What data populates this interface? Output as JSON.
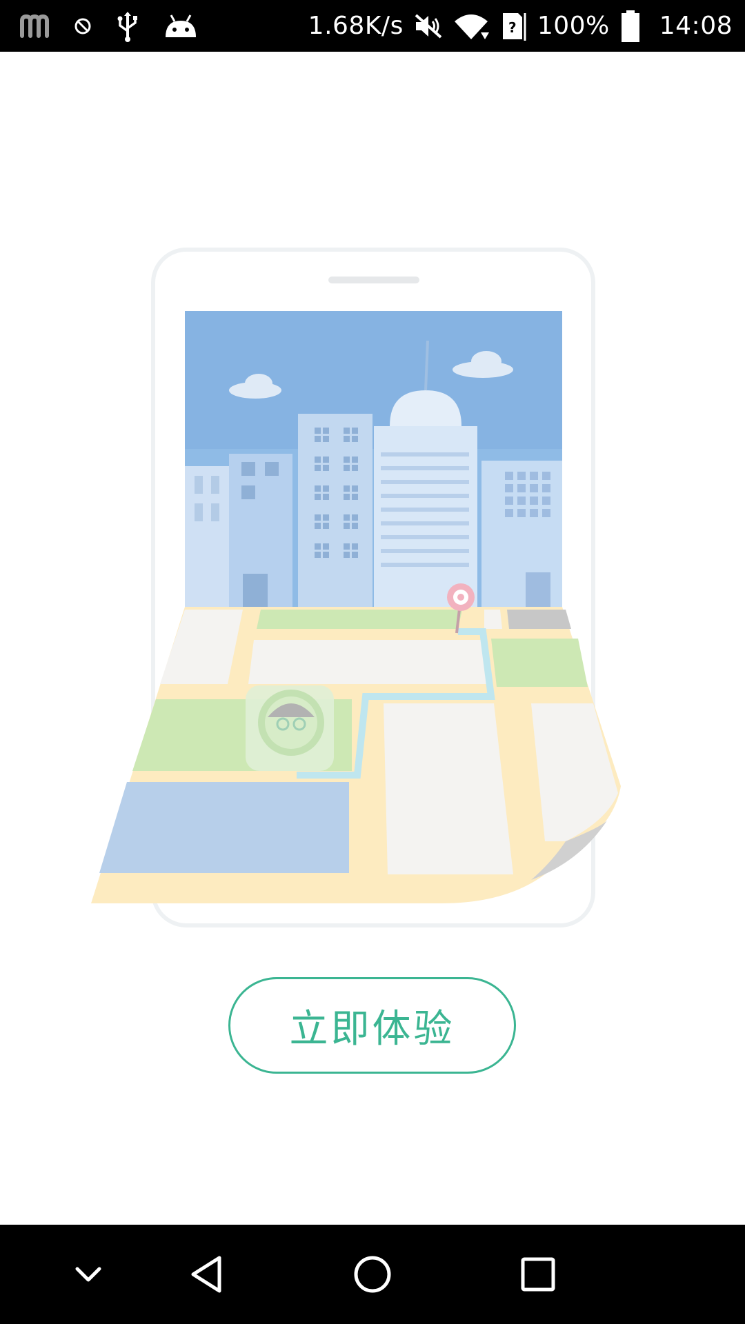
{
  "status_bar": {
    "network_speed": "1.68K/s",
    "battery_percent": "100%",
    "time": "14:08",
    "icons_left": [
      "m-app-icon",
      "blocked-icon",
      "usb-icon",
      "android-icon"
    ],
    "icons_right": [
      "mute-icon",
      "wifi-icon",
      "sim-unknown-icon",
      "battery-icon"
    ]
  },
  "illustration": {
    "description_icons": [
      "phone-frame",
      "city-skyline",
      "map-sheet",
      "destination-pin-icon",
      "user-avatar-icon",
      "route-line"
    ]
  },
  "cta": {
    "label": "立即体验"
  },
  "nav_bar": {
    "buttons": [
      "hide-keyboard-icon",
      "back-icon",
      "home-icon",
      "recents-icon"
    ]
  },
  "colors": {
    "accent": "#3bb592",
    "status_bar": "#000000",
    "nav_bar": "#000000",
    "background": "#ffffff"
  }
}
